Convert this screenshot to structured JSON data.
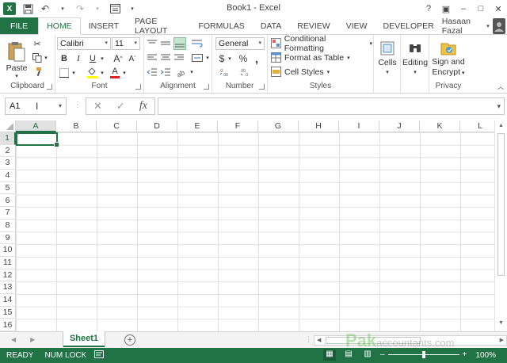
{
  "title": "Book1 - Excel",
  "window_controls": [
    "?",
    "▣",
    "–",
    "□",
    "✕"
  ],
  "tabs": {
    "file": "FILE",
    "items": [
      "HOME",
      "INSERT",
      "PAGE LAYOUT",
      "FORMULAS",
      "DATA",
      "REVIEW",
      "VIEW",
      "DEVELOPER"
    ],
    "active": "HOME"
  },
  "user": {
    "name": "Hasaan Fazal"
  },
  "ribbon": {
    "clipboard": {
      "label": "Clipboard",
      "paste": "Paste"
    },
    "font": {
      "label": "Font",
      "name": "Calibri",
      "size": "11",
      "bold": "B",
      "italic": "I",
      "underline": "U",
      "grow": "A",
      "shrink": "A"
    },
    "alignment": {
      "label": "Alignment"
    },
    "number": {
      "label": "Number",
      "format": "General",
      "currency": "$",
      "percent": "%",
      "comma": ","
    },
    "styles": {
      "label": "Styles",
      "conditional": "Conditional Formatting",
      "table": "Format as Table",
      "cell_styles": "Cell Styles"
    },
    "cells": {
      "label": "Cells"
    },
    "editing": {
      "label": "Editing"
    },
    "privacy": {
      "label": "Privacy",
      "sign": "Sign and",
      "encrypt": "Encrypt"
    }
  },
  "formula_bar": {
    "name_box": "A1",
    "fx": "fx",
    "value": ""
  },
  "columns": [
    "A",
    "B",
    "C",
    "D",
    "E",
    "F",
    "G",
    "H",
    "I",
    "J",
    "K",
    "L"
  ],
  "rows": [
    "1",
    "2",
    "3",
    "4",
    "5",
    "6",
    "7",
    "8",
    "9",
    "10",
    "11",
    "12",
    "13",
    "14",
    "15",
    "16"
  ],
  "active_cell": "A1",
  "sheets": [
    "Sheet1"
  ],
  "watermark": {
    "main": "Pak",
    "sub": "accountants.com"
  },
  "status": {
    "ready": "READY",
    "numlock": "NUM LOCK",
    "zoom": "100%"
  },
  "colors": {
    "accent": "#217346"
  }
}
